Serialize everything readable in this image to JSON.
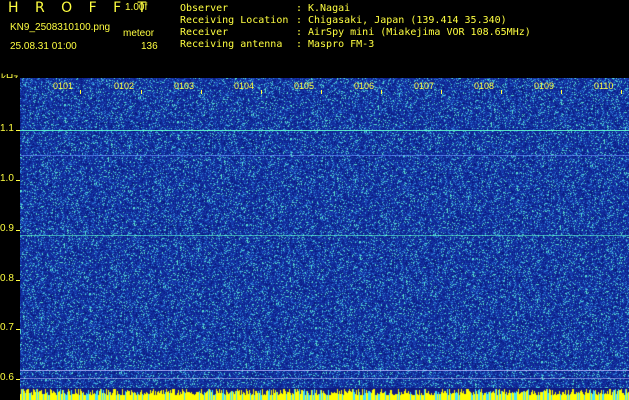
{
  "header": {
    "app_title": "H R O F F T",
    "version": "1.00f",
    "filename": "KN9_2508310100.png",
    "mode": "meteor",
    "datetime": "25.08.31 01:00",
    "count": "136",
    "info": [
      {
        "key": "Observer",
        "value": "K.Nagai"
      },
      {
        "key": "Receiving Location",
        "value": "Chigasaki, Japan (139.414 35.340)"
      },
      {
        "key": "Receiver",
        "value": "AirSpy mini (Miakejima VOR 108.65MHz)"
      },
      {
        "key": "Receiving antenna",
        "value": "Maspro FM-3"
      }
    ],
    "separator": ":"
  },
  "axis": {
    "y_unit": "kHz",
    "y_ticks": [
      "1.1",
      "1.0",
      "0.9",
      "0.8",
      "0.7",
      "0.6"
    ],
    "x_ticks": [
      "0101",
      "0102",
      "0103",
      "0104",
      "0105",
      "0106",
      "0107",
      "0108",
      "0109",
      "0110"
    ]
  },
  "colors": {
    "background": "#000000",
    "plot_bg": "#1a3aa8",
    "text": "#ffff40",
    "noise_dark": "#0a1e8c",
    "noise_bright": "#5ef0d8",
    "carrier_line": "#60ffd0",
    "grid_line": "#b8b8ff",
    "bottom_bar": "#ffff00"
  }
}
